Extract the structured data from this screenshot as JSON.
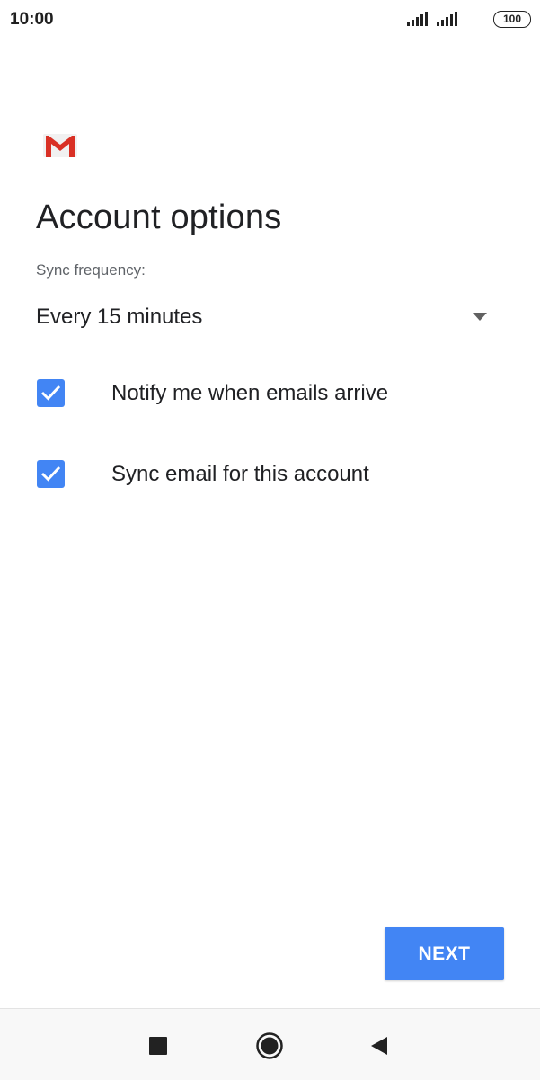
{
  "status_bar": {
    "time": "10:00",
    "battery": "100",
    "icons": [
      "signal-icon",
      "signal-icon",
      "battery-icon"
    ]
  },
  "app": {
    "logo_icon": "gmail-logo-icon",
    "accent_color": "#4285f4"
  },
  "main": {
    "title": "Account options",
    "sync_label": "Sync frequency:",
    "sync_value": "Every 15 minutes",
    "options": [
      {
        "label": "Notify me when emails arrive",
        "checked": true
      },
      {
        "label": "Sync email for this account",
        "checked": true
      }
    ]
  },
  "footer": {
    "next_label": "NEXT"
  },
  "nav_bar": {
    "icons": [
      "recents-icon",
      "home-icon",
      "back-icon"
    ]
  }
}
